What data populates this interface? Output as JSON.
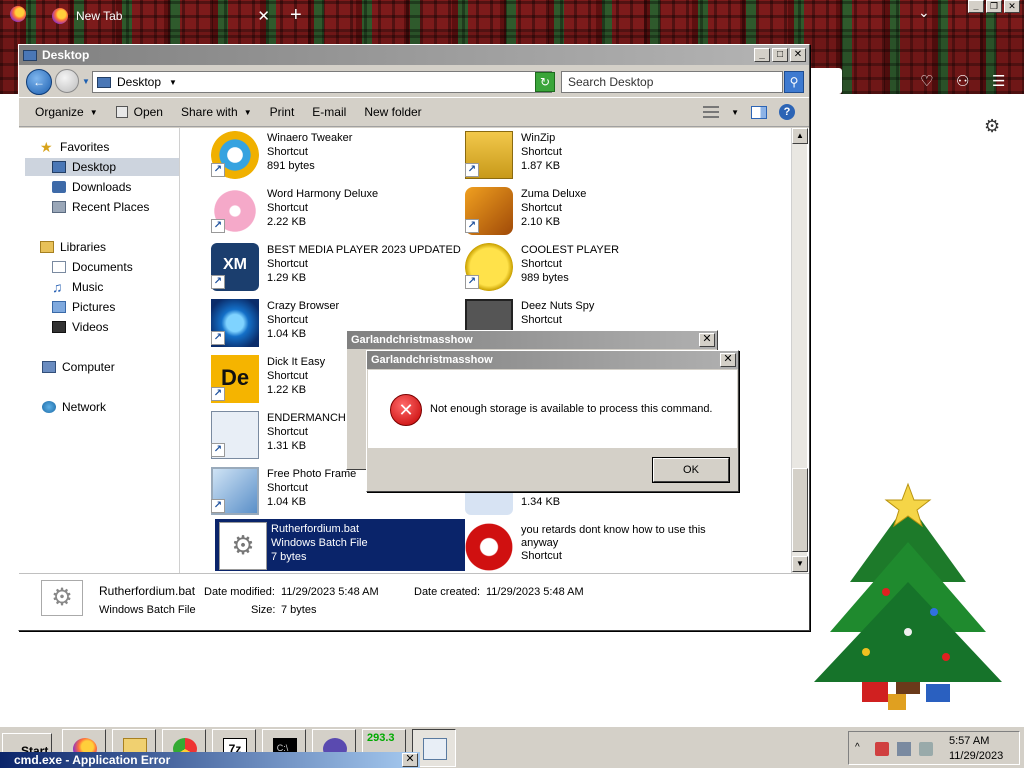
{
  "browser": {
    "tab_title": "New Tab",
    "new_tab_symbol": "+",
    "close_tab_symbol": "✕"
  },
  "explorer": {
    "title": "Desktop",
    "address": {
      "location": "Desktop"
    },
    "search": {
      "placeholder": "Search Desktop"
    },
    "toolbar": {
      "organize": "Organize",
      "open": "Open",
      "share_with": "Share with",
      "print": "Print",
      "email": "E-mail",
      "new_folder": "New folder"
    },
    "nav": {
      "favorites": "Favorites",
      "desktop": "Desktop",
      "downloads": "Downloads",
      "recent_places": "Recent Places",
      "libraries": "Libraries",
      "documents": "Documents",
      "music": "Music",
      "pictures": "Pictures",
      "videos": "Videos",
      "computer": "Computer",
      "network": "Network"
    },
    "files": [
      {
        "name": "Winaero Tweaker",
        "type": "Shortcut",
        "size": "891 bytes"
      },
      {
        "name": "WinZip",
        "type": "Shortcut",
        "size": "1.87 KB"
      },
      {
        "name": "Word Harmony Deluxe",
        "type": "Shortcut",
        "size": "2.22 KB"
      },
      {
        "name": "Zuma Deluxe",
        "type": "Shortcut",
        "size": "2.10 KB"
      },
      {
        "name": "BEST MEDIA PLAYER 2023 UPDATED",
        "type": "Shortcut",
        "size": "1.29 KB"
      },
      {
        "name": "COOLEST PLAYER",
        "type": "Shortcut",
        "size": "989 bytes"
      },
      {
        "name": "Crazy Browser",
        "type": "Shortcut",
        "size": "1.04 KB"
      },
      {
        "name": "Deez Nuts Spy",
        "type": "Shortcut",
        "size": ""
      },
      {
        "name": "Dick It Easy",
        "type": "Shortcut",
        "size": "1.22 KB"
      },
      {
        "name": "ENDERMANCH@NoE",
        "type": "Shortcut",
        "size": "1.31 KB"
      },
      {
        "name": "Free Photo Frame",
        "type": "Shortcut",
        "size": "1.04 KB"
      },
      {
        "name": "",
        "type": "Shortcut",
        "size": "1.34 KB"
      },
      {
        "name": "Rutherfordium.bat",
        "type": "Windows Batch File",
        "size": "7 bytes"
      },
      {
        "name": "you retards dont know how to use this anyway",
        "type": "Shortcut",
        "size": ""
      }
    ],
    "details": {
      "name": "Rutherfordium.bat",
      "type": "Windows Batch File",
      "modified_label": "Date modified:",
      "modified_value": "11/29/2023 5:48 AM",
      "created_label": "Date created:",
      "created_value": "11/29/2023 5:48 AM",
      "size_label": "Size:",
      "size_value": "7 bytes"
    }
  },
  "dialog_back": {
    "title": "Garlandchristmasshow"
  },
  "dialog_front": {
    "title": "Garlandchristmasshow",
    "message": "Not enough storage is available to process this command.",
    "ok": "OK"
  },
  "taskbar": {
    "start": "Start",
    "cpu_value": "293.3",
    "time": "5:57 AM",
    "date": "11/29/2023",
    "error_window": "cmd.exe - Application Error"
  }
}
